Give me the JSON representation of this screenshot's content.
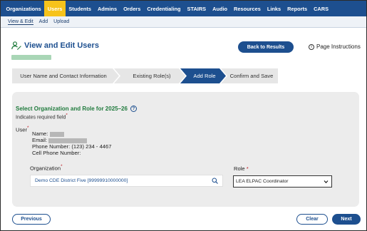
{
  "topnav": {
    "items": [
      {
        "label": "Organizations"
      },
      {
        "label": "Users",
        "active": true
      },
      {
        "label": "Students"
      },
      {
        "label": "Admins"
      },
      {
        "label": "Orders"
      },
      {
        "label": "Credentialing"
      },
      {
        "label": "STAIRS"
      },
      {
        "label": "Audio"
      },
      {
        "label": "Resources"
      },
      {
        "label": "Links"
      },
      {
        "label": "Reports"
      },
      {
        "label": "CARS"
      }
    ]
  },
  "subnav": {
    "items": [
      {
        "label": "View & Edit",
        "active": true
      },
      {
        "label": "Add"
      },
      {
        "label": "Upload"
      }
    ]
  },
  "header": {
    "title": "View and Edit Users",
    "back_button": "Back to Results",
    "page_instructions": "Page Instructions",
    "info_glyph": "i"
  },
  "stepper": {
    "steps": [
      {
        "label": "User Name and Contact Information",
        "state": "done"
      },
      {
        "label": "Existing Role(s)",
        "state": "done"
      },
      {
        "label": "Add Role",
        "state": "current"
      },
      {
        "label": "Confirm and Save",
        "state": "upcoming"
      }
    ]
  },
  "form": {
    "section_title": "Select Organization and Role for 2025–26",
    "help_glyph": "?",
    "required_text": "Indicates required field",
    "required_mark": "*",
    "user_label": "User",
    "name_label": "Name:",
    "email_label": "Email:",
    "phone_label": "Phone Number:",
    "phone_value": "(123) 234 - 4467",
    "cell_label": "Cell Phone Number:",
    "organization_label": "Organization",
    "organization_value": "Demo CDE District Five [99999910000000]",
    "role_label": "Role",
    "role_value": "LEA ELPAC Coordinator"
  },
  "footer": {
    "previous": "Previous",
    "clear": "Clear",
    "next": "Next"
  },
  "colors": {
    "nav_blue": "#1d4f8f",
    "active_tab": "#f7c31b",
    "section_green": "#1f7a3c",
    "required_red": "#c0141e",
    "step_done_bg": "#e6e6e6",
    "step_current_bg": "#1d4f8f"
  },
  "icons": {
    "title_icon": "user-edit-icon",
    "info_icon": "info-circle-icon",
    "help_icon": "question-circle-icon",
    "search_icon": "search-icon",
    "select_icon": "chevron-down-icon"
  }
}
